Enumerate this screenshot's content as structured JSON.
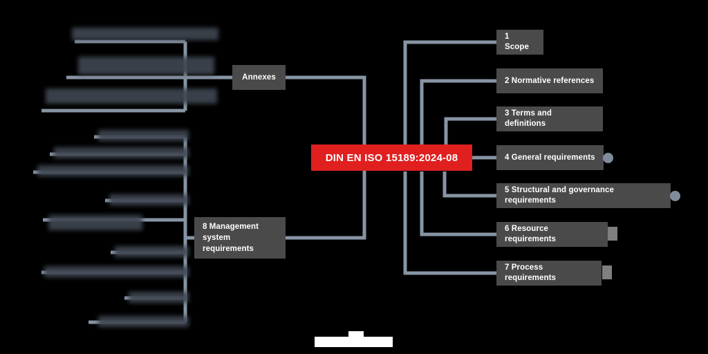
{
  "diagram": {
    "type": "mind-map",
    "title": "DIN EN ISO 15189:2024-08",
    "background_color": "#000000",
    "center_node_color": "#e01f1f",
    "node_color": "#4a4a4a",
    "connector_color": "#8794a3",
    "redacted_node_color": "#3f4651"
  },
  "center": {
    "label": "DIN EN ISO 15189:2024-08"
  },
  "right_branch": [
    {
      "label": "1 Scope",
      "has_handle": false
    },
    {
      "label": "2 Normative references",
      "has_handle": false
    },
    {
      "label": "3 Terms and definitions",
      "has_handle": false
    },
    {
      "label": "4 General requirements",
      "has_handle": true
    },
    {
      "label": "5 Structural and governance requirements",
      "has_handle": true
    },
    {
      "label": "6 Resource requirements",
      "has_handle": true
    },
    {
      "label": "7 Process requirements",
      "has_handle": true
    }
  ],
  "left_branch": [
    {
      "label": "Annexes",
      "children_count": 3,
      "children_redacted": true
    },
    {
      "label": "8 Management\nsystem\nrequirements",
      "children_count": 10,
      "children_redacted": true
    }
  ],
  "redacted": {
    "note": "",
    "bottom_bar": ""
  }
}
